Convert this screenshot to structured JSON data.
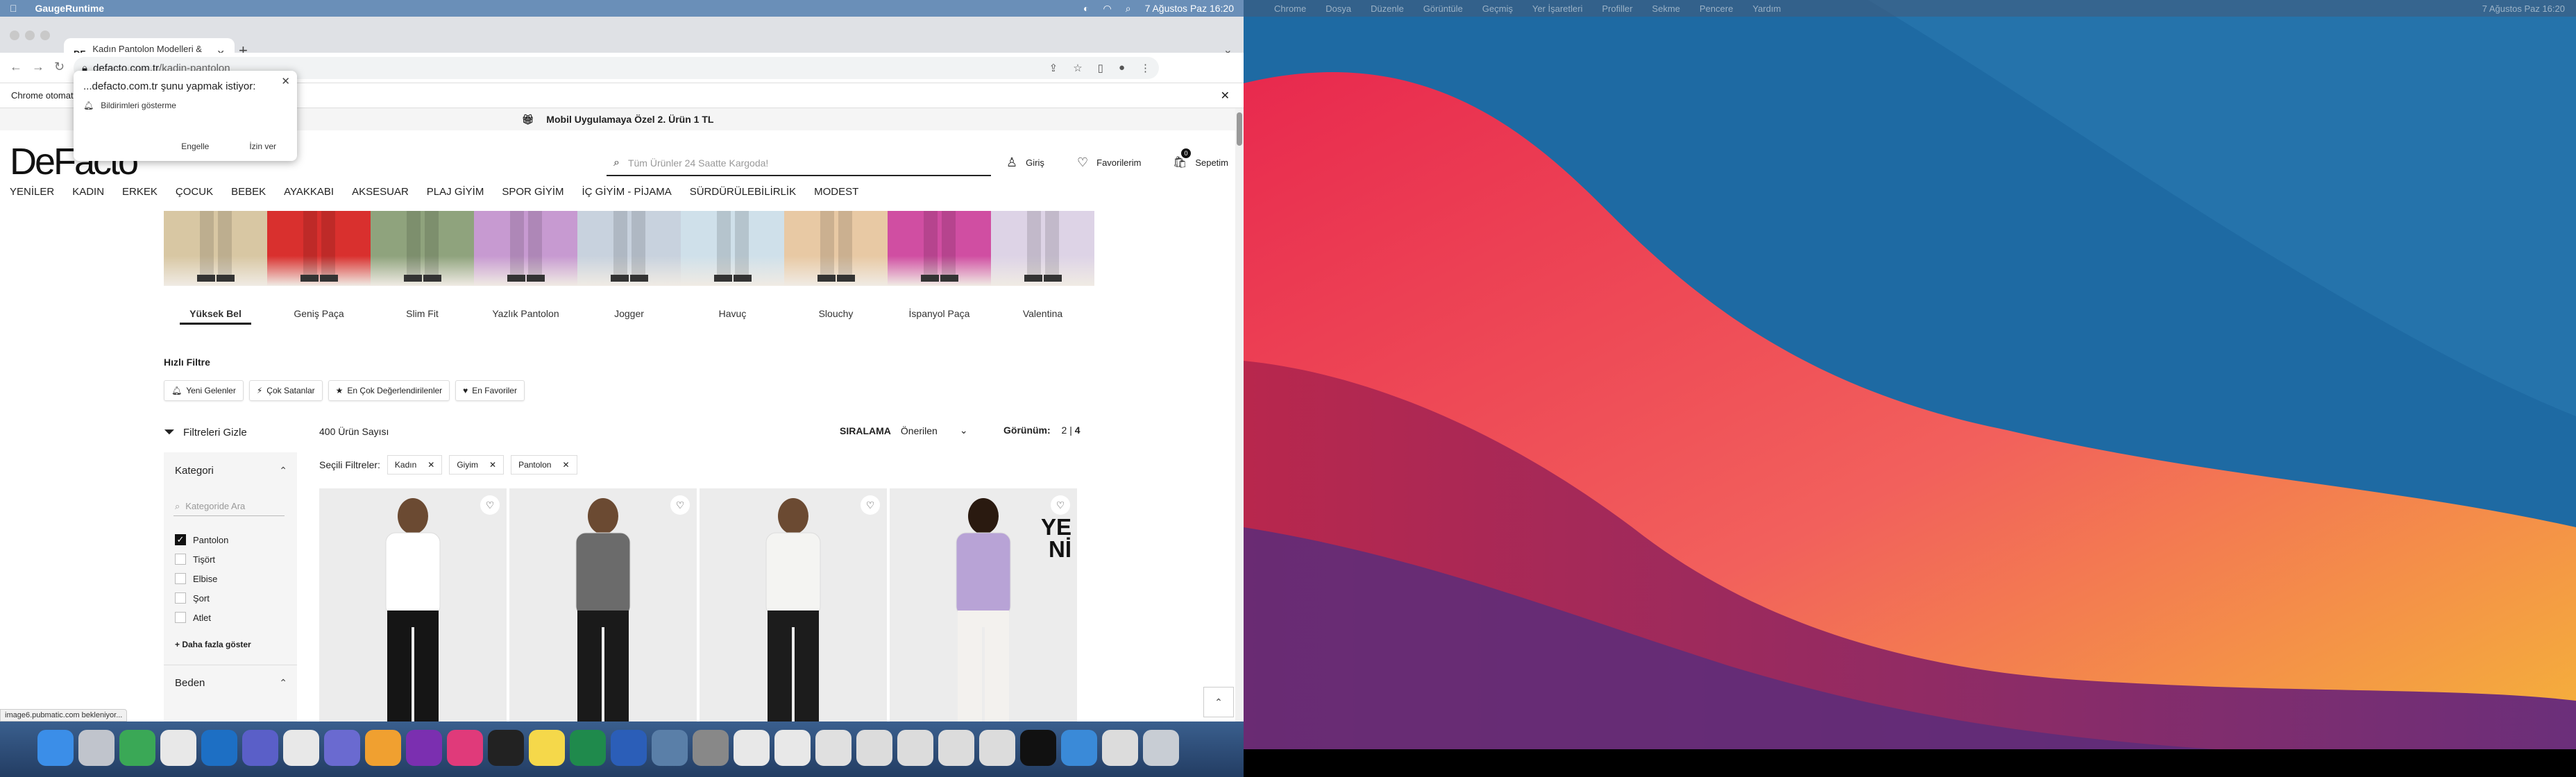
{
  "left_menubar": {
    "app": "GaugeRuntime",
    "clock": "7 Ağustos Paz  16:20"
  },
  "browser": {
    "tab_title": "Kadın Pantolon Modelleri & Fiy...",
    "tab_favicon": "DF",
    "url_domain": "defacto.com.tr",
    "url_path": "/kadin-pantolon",
    "infobar_text": "Chrome otomat"
  },
  "notif_popup": {
    "title": "...defacto.com.tr şunu yapmak istiyor:",
    "item": "Bildirimleri gösterme",
    "block": "Engelle",
    "allow": "İzin ver"
  },
  "promo": "Mobil Uygulamaya Özel 2. Ürün 1 TL",
  "header": {
    "logo": "DeFacto",
    "search_placeholder": "Tüm Ürünler 24 Saatte Kargoda!",
    "login": "Giriş",
    "favorites": "Favorilerim",
    "cart": "Sepetim",
    "cart_count": "0"
  },
  "categories": [
    "YENİLER",
    "KADIN",
    "ERKEK",
    "ÇOCUK",
    "BEBEK",
    "AYAKKABI",
    "AKSESUAR",
    "PLAJ GİYİM",
    "SPOR GİYİM",
    "İÇ GİYİM - PİJAMA",
    "SÜRDÜRÜLEBİLİRLİK",
    "MODEST"
  ],
  "styles": [
    {
      "label": "Yüksek Bel",
      "color": "#d8c7a3"
    },
    {
      "label": "Geniş Paça",
      "color": "#d9302e"
    },
    {
      "label": "Slim Fit",
      "color": "#8fa37d"
    },
    {
      "label": "Yazlık Pantolon",
      "color": "#c79ad1"
    },
    {
      "label": "Jogger",
      "color": "#c8d2de"
    },
    {
      "label": "Havuç",
      "color": "#cfe0ea"
    },
    {
      "label": "Slouchy",
      "color": "#e8c9a4"
    },
    {
      "label": "İspanyol Paça",
      "color": "#d04ea2"
    },
    {
      "label": "Valentina",
      "color": "#ddd3e6"
    }
  ],
  "quick_filter": {
    "title": "Hızlı Filtre",
    "chips": [
      "Yeni Gelenler",
      "Çok Satanlar",
      "En Çok Değerlendirilenler",
      "En Favoriler"
    ]
  },
  "listing": {
    "filter_hide": "Filtreleri Gizle",
    "count": "400 Ürün Sayısı",
    "sort_label": "SIRALAMA",
    "sort_value": "Önerilen",
    "view_label": "Görünüm:",
    "view_2": "2",
    "view_sep": "|",
    "view_4": "4",
    "selected_label": "Seçili Filtreler:",
    "selected": [
      "Kadın",
      "Giyim",
      "Pantolon"
    ]
  },
  "sidebar": {
    "category_title": "Kategori",
    "search_placeholder": "Kategoride Ara",
    "items": [
      {
        "label": "Pantolon",
        "checked": true
      },
      {
        "label": "Tişört",
        "checked": false
      },
      {
        "label": "Elbise",
        "checked": false
      },
      {
        "label": "Şort",
        "checked": false
      },
      {
        "label": "Atlet",
        "checked": false
      }
    ],
    "more": "+ Daha fazla göster",
    "size_title": "Beden"
  },
  "products": [
    {
      "top": "#ffffff",
      "bottom": "#151515"
    },
    {
      "top": "#6b6b6b",
      "bottom": "#1a1a1a"
    },
    {
      "top": "#f4f4f2",
      "bottom": "#1c1c1c"
    },
    {
      "top": "#b8a3d6",
      "bottom": "#f3f1ee"
    }
  ],
  "new_badge_line1": "YE",
  "new_badge_line2": "Nİ",
  "status_text": "image6.pubmatic.com bekleniyor...",
  "right_menubar": {
    "items": [
      "Chrome",
      "Dosya",
      "Düzenle",
      "Görüntüle",
      "Geçmiş",
      "Yer İşaretleri",
      "Profiller",
      "Sekme",
      "Pencere",
      "Yardım"
    ],
    "clock": "7 Ağustos Paz  16:20"
  }
}
